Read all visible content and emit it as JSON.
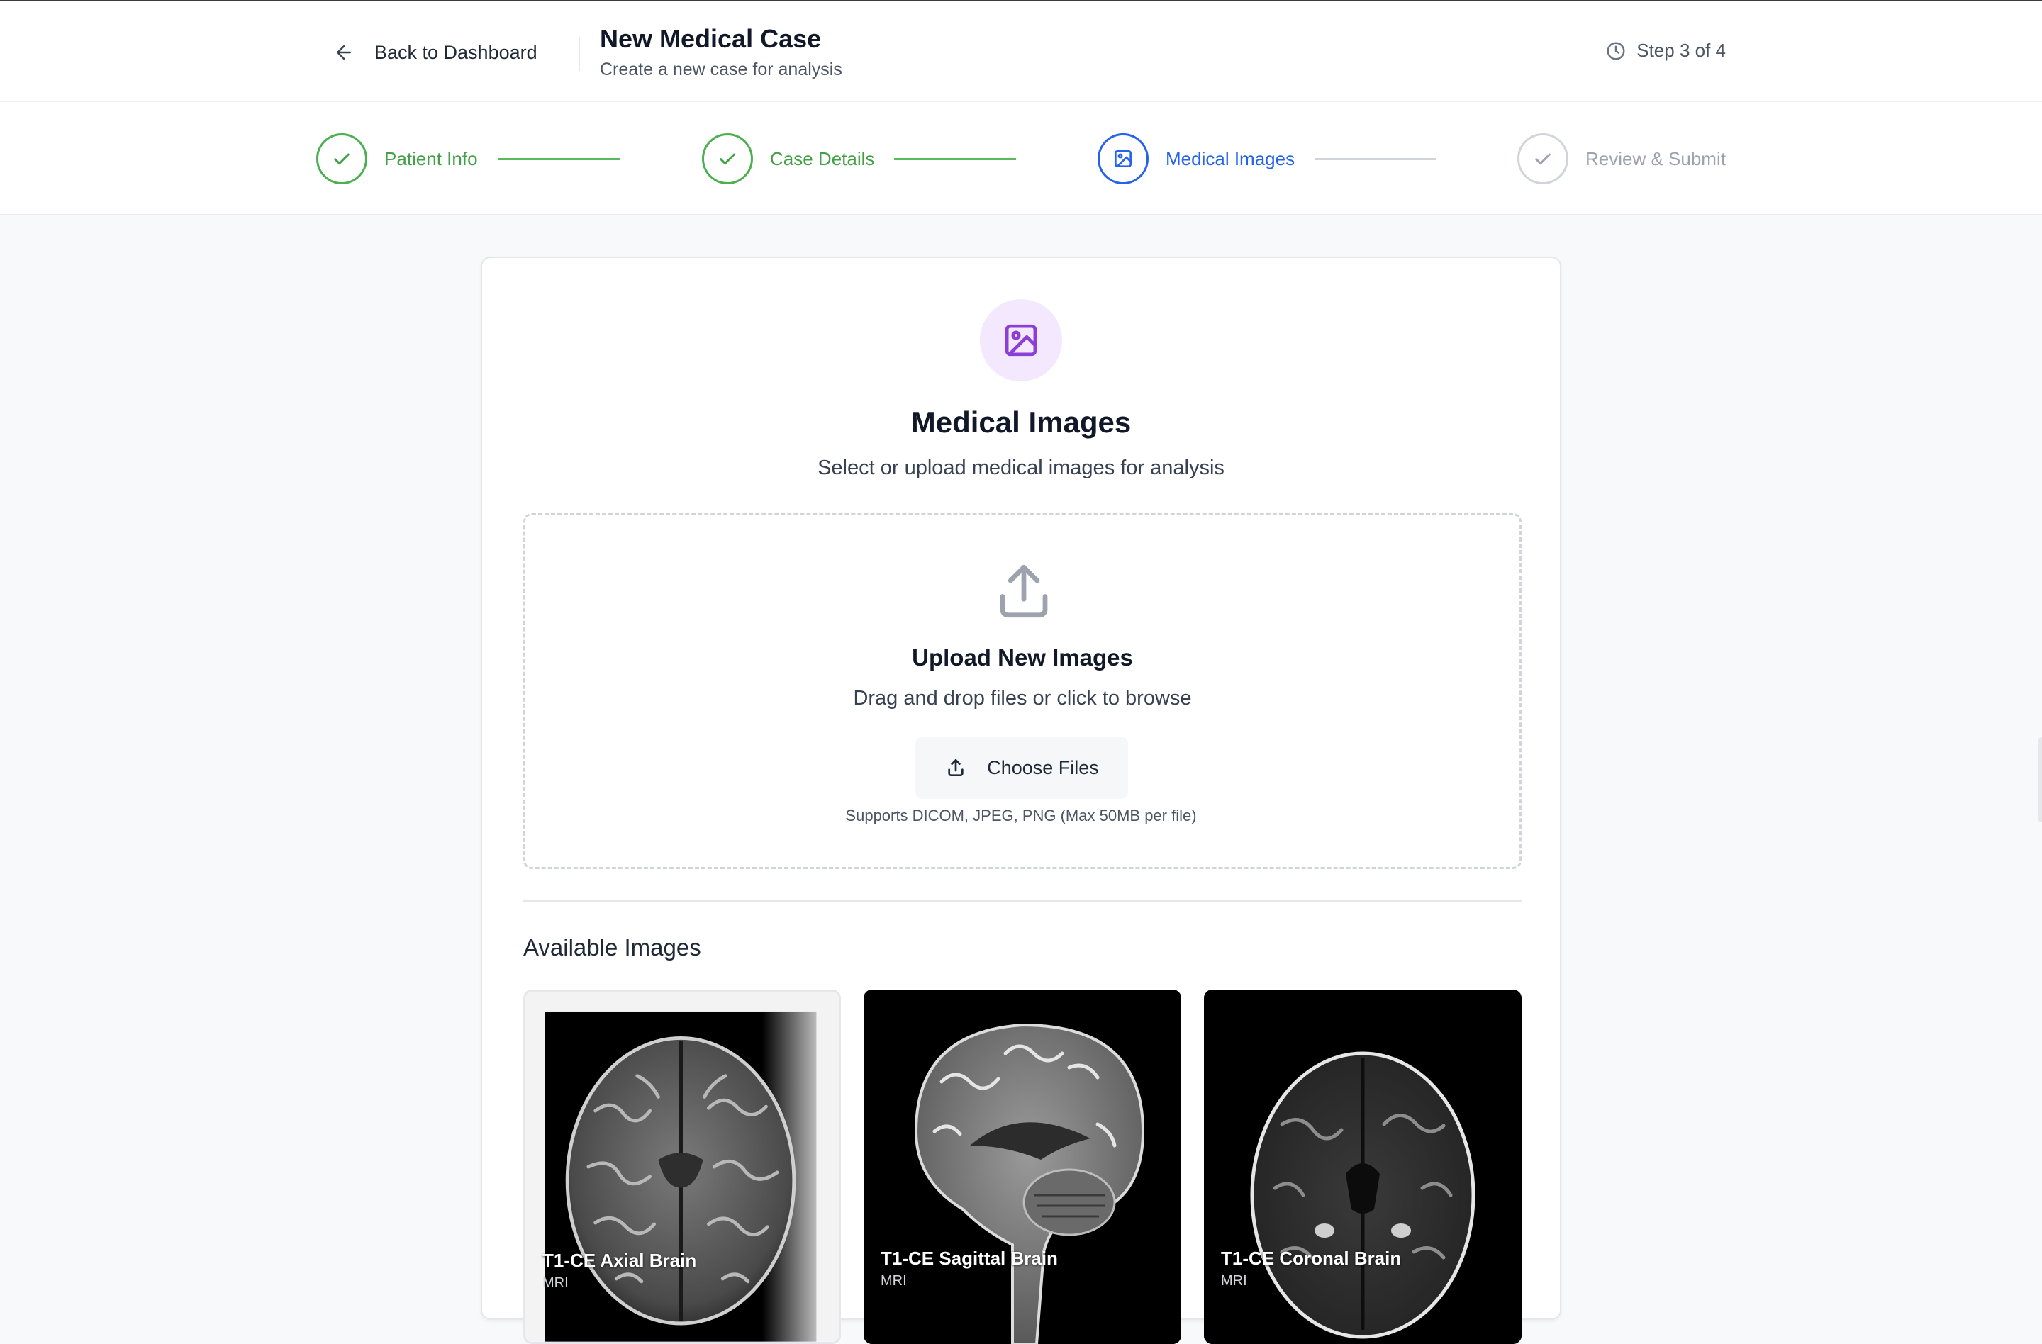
{
  "header": {
    "back_label": "Back to Dashboard",
    "title": "New Medical Case",
    "subtitle": "Create a new case for analysis",
    "step_text": "Step 3 of 4"
  },
  "stepper": {
    "steps": [
      {
        "label": "Patient Info",
        "state": "done"
      },
      {
        "label": "Case Details",
        "state": "done"
      },
      {
        "label": "Medical Images",
        "state": "current"
      },
      {
        "label": "Review & Submit",
        "state": "pending"
      }
    ]
  },
  "card": {
    "title": "Medical Images",
    "subtitle": "Select or upload medical images for analysis"
  },
  "upload": {
    "title": "Upload New Images",
    "text": "Drag and drop files or click to browse",
    "button_label": "Choose Files",
    "hint": "Supports DICOM, JPEG, PNG (Max 50MB per file)"
  },
  "available": {
    "title": "Available Images",
    "images": [
      {
        "name": "T1-CE Axial Brain",
        "modality": "MRI"
      },
      {
        "name": "T1-CE Sagittal Brain",
        "modality": "MRI"
      },
      {
        "name": "T1-CE Coronal Brain",
        "modality": "MRI"
      }
    ]
  },
  "colors": {
    "done": "#43a047",
    "current": "#2563eb",
    "pending": "#9ca3af",
    "hero_bg": "#f3e8fd",
    "hero_icon": "#8b3fd6"
  }
}
